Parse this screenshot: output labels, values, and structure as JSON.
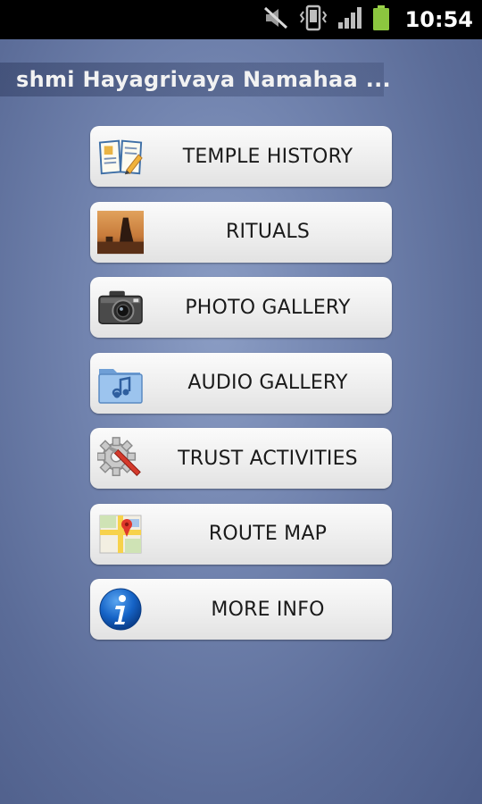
{
  "status_bar": {
    "time": "10:54",
    "icons": [
      "mute-icon",
      "vibrate-icon",
      "signal-icon",
      "battery-icon"
    ],
    "battery_color": "#8cc63f"
  },
  "app": {
    "title": "shmi Hayagrivaya Namahaa ..."
  },
  "menu": {
    "items": [
      {
        "label": "TEMPLE HISTORY",
        "icon": "book-icon"
      },
      {
        "label": "RITUALS",
        "icon": "rituals-photo-icon"
      },
      {
        "label": "PHOTO GALLERY",
        "icon": "camera-icon"
      },
      {
        "label": "AUDIO GALLERY",
        "icon": "music-folder-icon"
      },
      {
        "label": "TRUST ACTIVITIES",
        "icon": "tools-gear-icon"
      },
      {
        "label": "ROUTE MAP",
        "icon": "map-icon"
      },
      {
        "label": "MORE INFO",
        "icon": "info-icon"
      }
    ]
  }
}
